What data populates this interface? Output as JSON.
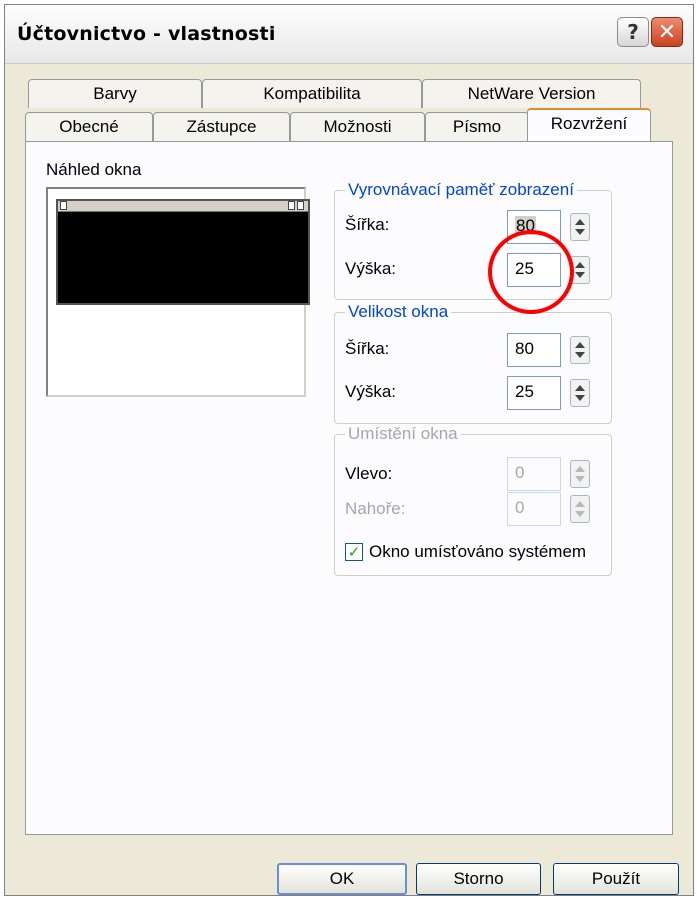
{
  "window": {
    "title": "Účtovnictvo - vlastnosti",
    "help_glyph": "?",
    "close_glyph": "✕"
  },
  "tabs": {
    "back_row": [
      "Barvy",
      "Kompatibilita",
      "NetWare Version"
    ],
    "front_row": [
      "Obecné",
      "Zástupce",
      "Možnosti",
      "Písmo",
      "Rozvržení"
    ],
    "selected": "Rozvržení"
  },
  "preview": {
    "label": "Náhled okna"
  },
  "buffer_group": {
    "title": "Vyrovnávací paměť zobrazení",
    "width_label": "Šířka:",
    "width_value": "80",
    "height_label": "Výška:",
    "height_value": "25"
  },
  "size_group": {
    "title": "Velikost okna",
    "width_label": "Šířka:",
    "width_value": "80",
    "height_label": "Výška:",
    "height_value": "25"
  },
  "position_group": {
    "title": "Umístění okna",
    "left_label": "Vlevo:",
    "left_value": "0",
    "top_label": "Nahoře:",
    "top_value": "0",
    "checkbox_label": "Okno umísťováno systémem",
    "checkbox_checked": true
  },
  "buttons": {
    "ok": "OK",
    "cancel": "Storno",
    "apply": "Použít"
  },
  "colors": {
    "group_title": "#0046d5",
    "tab_highlight": "#e68b2c",
    "annotation_circle": "#ff0000"
  }
}
